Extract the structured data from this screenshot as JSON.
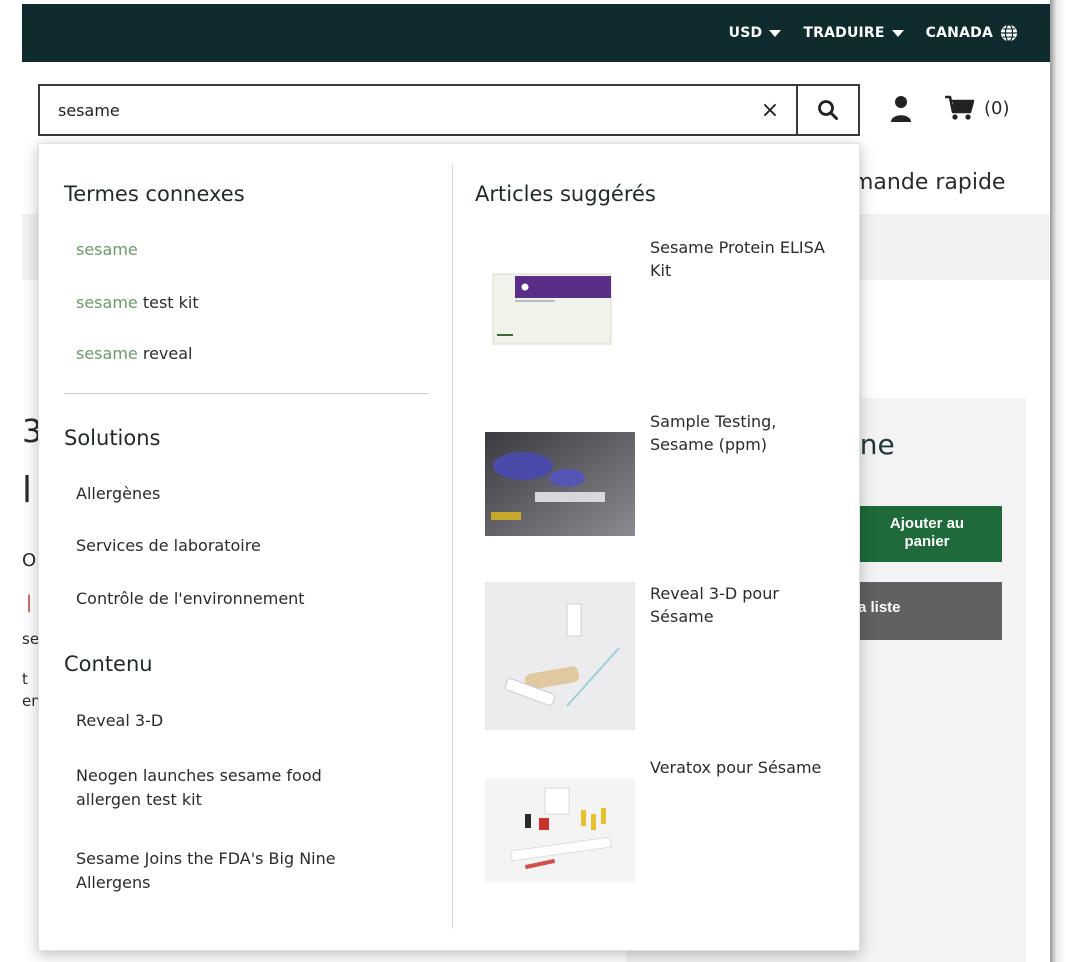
{
  "topbar": {
    "currency_label": "USD",
    "translate_label": "TRADUIRE",
    "region_label": "CANADA"
  },
  "header": {
    "search_value": "sesame",
    "clear_glyph": "×",
    "cart_count": "(0)"
  },
  "background": {
    "quick_order_fragment": "mande rapide",
    "heading_fragment": "ıne",
    "add_to_cart_label_line1": "Ajouter au",
    "add_to_cart_label_line2": "panier",
    "list_label": "a liste",
    "left_frag_1": "3",
    "left_frag_2": "l",
    "left_frag_3": "O",
    "left_frag_4": "|",
    "left_frag_5": "se",
    "left_frag_6": "t",
    "left_frag_7": "en"
  },
  "dropdown": {
    "related_terms": {
      "title": "Termes connexes",
      "items": [
        {
          "highlight": "sesame",
          "rest": ""
        },
        {
          "highlight": "sesame",
          "rest": " test kit"
        },
        {
          "highlight": "sesame",
          "rest": " reveal"
        }
      ]
    },
    "solutions": {
      "title": "Solutions",
      "items": [
        "Allergènes",
        "Services de laboratoire",
        "Contrôle de l'environnement"
      ]
    },
    "content": {
      "title": "Contenu",
      "items": [
        "Reveal 3-D",
        "Neogen launches sesame food allergen test kit",
        "Sesame Joins the FDA's Big Nine Allergens"
      ]
    },
    "suggested": {
      "title": "Articles suggérés",
      "products": [
        {
          "name": "Sesame Protein ELISA Kit",
          "image": "elisa-kit-box-image"
        },
        {
          "name": "Sample Testing, Sesame (ppm)",
          "image": "lab-testing-photo"
        },
        {
          "name": "Reveal 3-D pour Sésame",
          "image": "reveal-test-strip-image"
        },
        {
          "name": "Veratox pour Sésame",
          "image": "veratox-kit-image"
        }
      ]
    }
  },
  "colors": {
    "topbar_bg": "#0f2b2d",
    "highlight_green": "#6a9a6a",
    "add_button_green": "#1e6a3a"
  }
}
